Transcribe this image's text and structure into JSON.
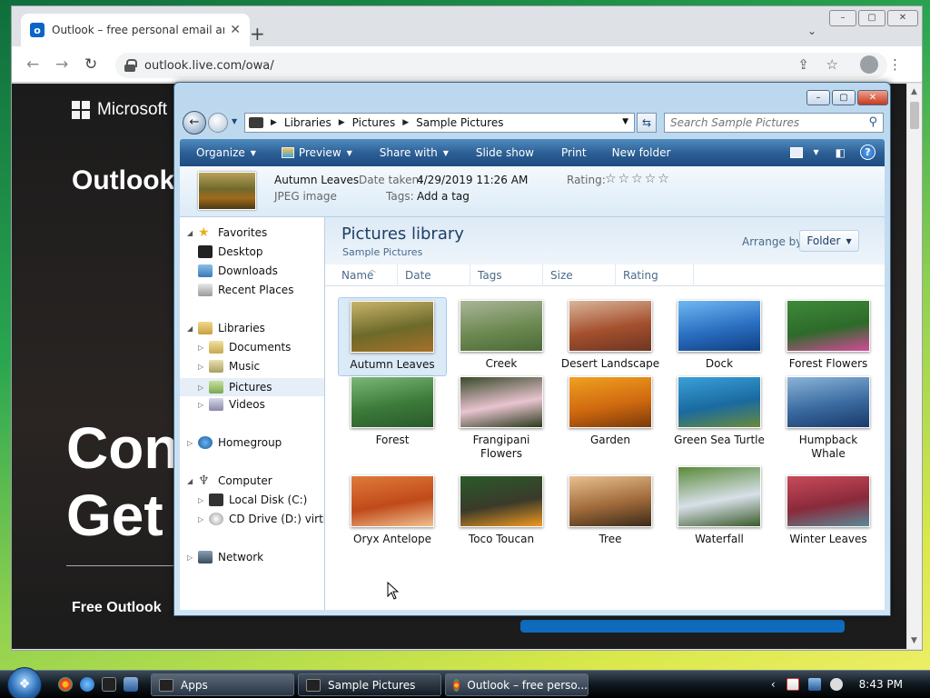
{
  "browser": {
    "tab_title": "Outlook – free personal email an",
    "new_tab": "+",
    "url": "outlook.live.com/owa/",
    "window_controls": [
      "–",
      "▢",
      "✕"
    ]
  },
  "outlook_page": {
    "brand": "Microsoft",
    "title": "Outlook",
    "headline_1": "Con",
    "headline_2": "Get",
    "free_line": "Free Outlook"
  },
  "explorer": {
    "address_crumbs": [
      "Libraries",
      "Pictures",
      "Sample Pictures"
    ],
    "search_placeholder": "Search Sample Pictures",
    "commands": {
      "organize": "Organize",
      "preview": "Preview",
      "share_with": "Share with",
      "slide_show": "Slide show",
      "print": "Print",
      "new_folder": "New folder"
    },
    "details": {
      "file_name": "Autumn Leaves",
      "file_type": "JPEG image",
      "date_taken_label": "Date taken:",
      "date_taken": "4/29/2019 11:26 AM",
      "tags_label": "Tags:",
      "tags_value": "Add a tag",
      "rating_label": "Rating:",
      "rating_stars": "☆☆☆☆☆",
      "rating_value": 0
    },
    "nav": {
      "favorites": "Favorites",
      "desktop": "Desktop",
      "downloads": "Downloads",
      "recent_places": "Recent Places",
      "libraries": "Libraries",
      "documents": "Documents",
      "music": "Music",
      "pictures": "Pictures",
      "videos": "Videos",
      "homegroup": "Homegroup",
      "computer": "Computer",
      "local_disk": "Local Disk (C:)",
      "cd_drive": "CD Drive (D:) virtio-v",
      "network": "Network"
    },
    "library": {
      "title": "Pictures library",
      "subtitle": "Sample Pictures",
      "arrange_label": "Arrange by:",
      "arrange_value": "Folder"
    },
    "columns": [
      "Name",
      "Date",
      "Tags",
      "Size",
      "Rating"
    ],
    "pictures": [
      {
        "name": "Autumn Leaves",
        "colors": [
          "#c9b46a",
          "#6d6a2a",
          "#a5702a"
        ],
        "selected": true
      },
      {
        "name": "Creek",
        "colors": [
          "#aab59a",
          "#6e8a52",
          "#4b6a38"
        ]
      },
      {
        "name": "Desert Landscape",
        "colors": [
          "#d9b59a",
          "#a4502e",
          "#6e3520"
        ]
      },
      {
        "name": "Dock",
        "colors": [
          "#6fb8f2",
          "#2b6fc2",
          "#0e3f82"
        ]
      },
      {
        "name": "Forest Flowers",
        "colors": [
          "#3e8a3a",
          "#2d6a2a",
          "#d44a9a"
        ]
      },
      {
        "name": "Forest",
        "colors": [
          "#7ab878",
          "#3c7a3a",
          "#2a5a2a"
        ]
      },
      {
        "name": "Frangipani Flowers",
        "colors": [
          "#3a4a2a",
          "#e8c4d0",
          "#2a3a1a"
        ]
      },
      {
        "name": "Garden",
        "colors": [
          "#f0a020",
          "#d06a10",
          "#7a3a08"
        ]
      },
      {
        "name": "Green Sea Turtle",
        "colors": [
          "#3aa0d8",
          "#1a6aa0",
          "#6a8a3a"
        ]
      },
      {
        "name": "Humpback Whale",
        "colors": [
          "#8ab4d8",
          "#3a6aa0",
          "#1a3a6a"
        ]
      },
      {
        "name": "Oryx Antelope",
        "colors": [
          "#e07a3a",
          "#c04a1a",
          "#f0c090"
        ]
      },
      {
        "name": "Toco Toucan",
        "colors": [
          "#2a5a2a",
          "#3a3a2a",
          "#f09a20"
        ]
      },
      {
        "name": "Tree",
        "colors": [
          "#e8c090",
          "#a06a3a",
          "#3a2a1a"
        ]
      },
      {
        "name": "Waterfall",
        "colors": [
          "#5a8a3a",
          "#d8e0e8",
          "#3a5a2a"
        ]
      },
      {
        "name": "Winter Leaves",
        "colors": [
          "#c84a5a",
          "#8a2a3a",
          "#5a8a9a"
        ]
      }
    ]
  },
  "taskbar": {
    "buttons": [
      "Apps",
      "Sample Pictures",
      "Outlook – free perso..."
    ],
    "clock": "8:43 PM"
  }
}
